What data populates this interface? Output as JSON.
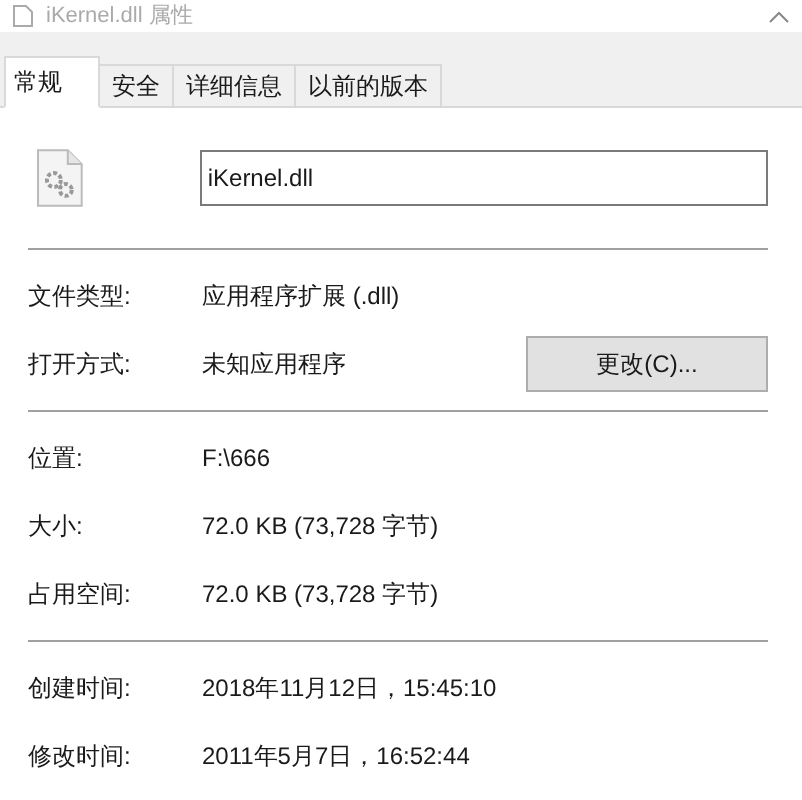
{
  "window": {
    "title": "iKernel.dll 属性"
  },
  "tabs": [
    {
      "label": "常规",
      "selected": true
    },
    {
      "label": "安全",
      "selected": false
    },
    {
      "label": "详细信息",
      "selected": false
    },
    {
      "label": "以前的版本",
      "selected": false
    }
  ],
  "file_name": "iKernel.dll",
  "sections": [
    [
      {
        "label": "文件类型:",
        "value": "应用程序扩展 (.dll)"
      },
      {
        "label": "打开方式:",
        "value": "未知应用程序",
        "button": "更改(C)..."
      }
    ],
    [
      {
        "label": "位置:",
        "value": "F:\\666"
      },
      {
        "label": "大小:",
        "value": "72.0 KB (73,728 字节)"
      },
      {
        "label": "占用空间:",
        "value": "72.0 KB (73,728 字节)"
      }
    ],
    [
      {
        "label": "创建时间:",
        "value": "2018年11月12日，15:45:10"
      },
      {
        "label": "修改时间:",
        "value": "2011年5月7日，16:52:44"
      }
    ]
  ]
}
